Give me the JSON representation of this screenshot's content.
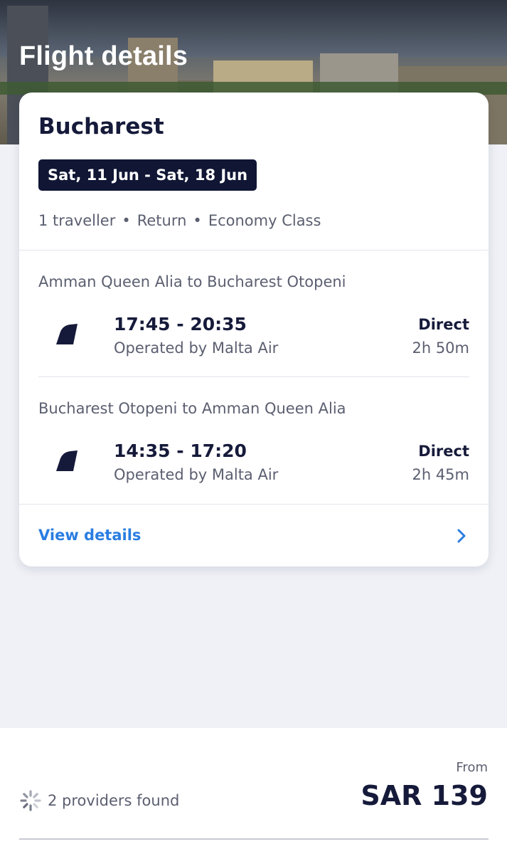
{
  "header": {
    "title": "Flight details"
  },
  "trip": {
    "destination": "Bucharest",
    "dates": "Sat, 11 Jun - Sat, 18 Jun",
    "travellers": "1 traveller",
    "trip_type": "Return",
    "cabin_class": "Economy Class",
    "separator": "•"
  },
  "legs": [
    {
      "route": "Amman Queen Alia to Bucharest Otopeni",
      "times": "17:45 - 20:35",
      "operator": "Operated by Malta Air",
      "stops": "Direct",
      "duration": "2h 50m",
      "airline_icon": "airline-tail-icon"
    },
    {
      "route": "Bucharest Otopeni to Amman Queen Alia",
      "times": "14:35 - 17:20",
      "operator": "Operated by Malta Air",
      "stops": "Direct",
      "duration": "2h 45m",
      "airline_icon": "airline-tail-icon"
    }
  ],
  "actions": {
    "view_details": "View details",
    "chevron_icon": "chevron-right-icon"
  },
  "footer": {
    "providers": "2 providers found",
    "price_prefix": "From",
    "price": "SAR 139",
    "spinner_icon": "loading-spinner-icon"
  },
  "colors": {
    "accent": "#2a7de1",
    "text_dark": "#161a3a",
    "chip_bg": "#101634",
    "text_muted": "#5b5f70",
    "page_bg": "#eff1f6"
  }
}
